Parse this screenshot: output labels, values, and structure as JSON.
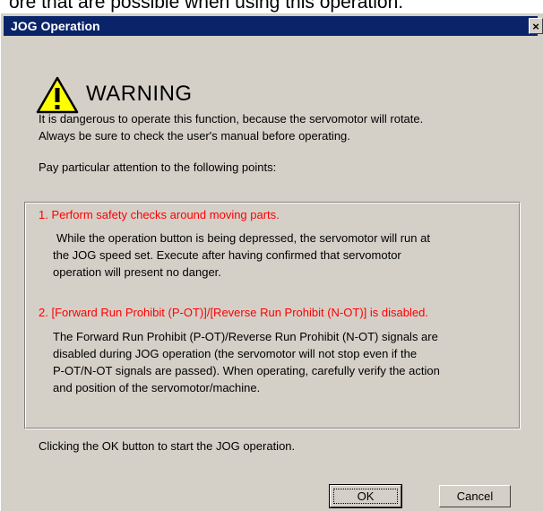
{
  "background_text": "ore that are possible when using this operation.",
  "dialog": {
    "title": "JOG Operation",
    "close_glyph": "×",
    "warning_label": "WARNING",
    "intro_lines": [
      "It is dangerous to operate this function, because the servomotor will rotate.",
      "Always be sure to check the user's manual before operating."
    ],
    "attention": "Pay particular attention to the following points:",
    "point1": {
      "heading": "1. Perform safety checks around moving parts.",
      "lines": [
        "While the operation button is being depressed, the servomotor will run at",
        "the JOG speed set. Execute after having confirmed that servomotor",
        "operation will present no danger."
      ]
    },
    "point2": {
      "heading": "2. [Forward Run Prohibit (P-OT)]/[Reverse Run Prohibit (N-OT)] is disabled.",
      "lines": [
        "The Forward Run Prohibit (P-OT)/Reverse Run Prohibit (N-OT) signals are",
        "disabled during JOG operation (the servomotor will not stop even if the",
        "P-OT/N-OT signals are passed). When operating, carefully verify the action",
        "and position of the  servomotor/machine."
      ]
    },
    "footer": "Clicking the OK button to start the JOG operation.",
    "ok_label": "OK",
    "cancel_label": "Cancel"
  },
  "colors": {
    "titlebar": "#0a246a",
    "dialog_bg": "#d4d0c8",
    "warning_text": "#ff0000",
    "warning_icon": "#ffff00"
  },
  "icons": {
    "warning": "warning-triangle-icon",
    "close": "close-icon"
  }
}
